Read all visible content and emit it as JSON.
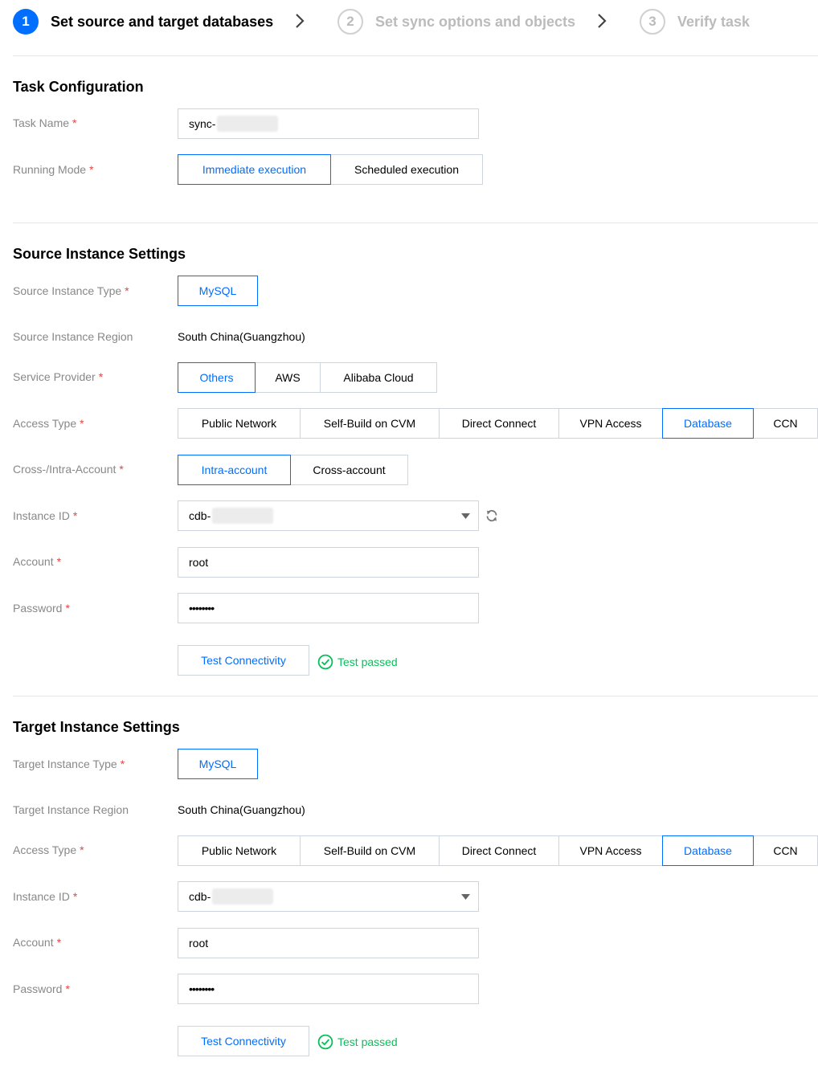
{
  "steps": [
    {
      "number": "1",
      "label": "Set source and target databases",
      "state": "active"
    },
    {
      "number": "2",
      "label": "Set sync options and objects",
      "state": "inactive"
    },
    {
      "number": "3",
      "label": "Verify task",
      "state": "inactive"
    }
  ],
  "task_config": {
    "title": "Task Configuration",
    "task_name_label": "Task Name",
    "task_name_value": "sync-",
    "running_mode_label": "Running Mode",
    "running_modes": [
      "Immediate execution",
      "Scheduled execution"
    ],
    "running_mode_selected": "Immediate execution"
  },
  "source": {
    "title": "Source Instance Settings",
    "instance_type_label": "Source Instance Type",
    "instance_type_value": "MySQL",
    "region_label": "Source Instance Region",
    "region_value": "South China(Guangzhou)",
    "service_provider_label": "Service Provider",
    "service_providers": [
      "Others",
      "AWS",
      "Alibaba Cloud"
    ],
    "service_provider_selected": "Others",
    "access_type_label": "Access Type",
    "access_types": [
      "Public Network",
      "Self-Build on CVM",
      "Direct Connect",
      "VPN Access",
      "Database",
      "CCN"
    ],
    "access_type_selected": "Database",
    "account_scope_label": "Cross-/Intra-Account",
    "account_scopes": [
      "Intra-account",
      "Cross-account"
    ],
    "account_scope_selected": "Intra-account",
    "instance_id_label": "Instance ID",
    "instance_id_value": "cdb-",
    "account_label": "Account",
    "account_value": "root",
    "password_label": "Password",
    "password_value": "••••••••",
    "test_button": "Test Connectivity",
    "test_status": "Test passed"
  },
  "target": {
    "title": "Target Instance Settings",
    "instance_type_label": "Target Instance Type",
    "instance_type_value": "MySQL",
    "region_label": "Target Instance Region",
    "region_value": "South China(Guangzhou)",
    "access_type_label": "Access Type",
    "access_types": [
      "Public Network",
      "Self-Build on CVM",
      "Direct Connect",
      "VPN Access",
      "Database",
      "CCN"
    ],
    "access_type_selected": "Database",
    "instance_id_label": "Instance ID",
    "instance_id_value": "cdb-",
    "account_label": "Account",
    "account_value": "root",
    "password_label": "Password",
    "password_value": "••••••••",
    "test_button": "Test Connectivity",
    "test_status": "Test passed"
  },
  "colors": {
    "accent": "#006eff",
    "success": "#0abf5b",
    "required": "#e54545",
    "label": "#888888"
  },
  "required_mark": "*"
}
